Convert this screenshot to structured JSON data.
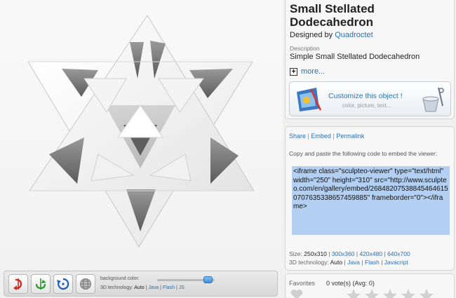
{
  "viewer": {
    "toolbar": {
      "bg_color_label": "background color:",
      "tech_label": "3D technology:",
      "tech_options": [
        "Auto",
        "Java",
        "Flash",
        "JS"
      ],
      "tech_sep": "|",
      "bg_level": 0.88
    }
  },
  "model": {
    "title_line1": "Small Stellated",
    "title_line2": "Dodecahedron",
    "designed_by_label": "Designed by",
    "designer": "Quadroctet",
    "description_label": "Description",
    "description": "Simple Small Stellated Dodecahedron",
    "more_label": "more..."
  },
  "customize": {
    "title": "Customize this object !",
    "subtitle": "color, picture, text...",
    "icon": "paint-tools-icon"
  },
  "share": {
    "links": [
      "Share",
      "Embed",
      "Permalink"
    ],
    "sep": "|",
    "instructions": "Copy and paste the following code to embed the viewer:",
    "embed_code": "<iframe class=\"sculpteo-viewer\" type=\"text/html\" width=\"250\" height=\"310\" src=\"http://www.sculpteo.com/en/gallery/embed/268482075388454646150707635338657459885\" frameborder=\"0\"></iframe>",
    "size_label": "Size:",
    "sizes": [
      "250x310",
      "300x360",
      "420x480",
      "640x700"
    ],
    "tech_label": "3D technology:",
    "tech_options": [
      "Auto",
      "Java",
      "Flash",
      "Javacript"
    ]
  },
  "favorites": {
    "label": "Favorites",
    "votes_text": "0 vote(s) (Avg: 0)",
    "rating": 0,
    "max_rating": 5
  },
  "colors": {
    "link": "#2a6fb4",
    "selection": "#b3d0f2",
    "model_face": "#ffffff",
    "model_shadow": "#7a7a7a",
    "star_empty": "#d0d0d0"
  }
}
